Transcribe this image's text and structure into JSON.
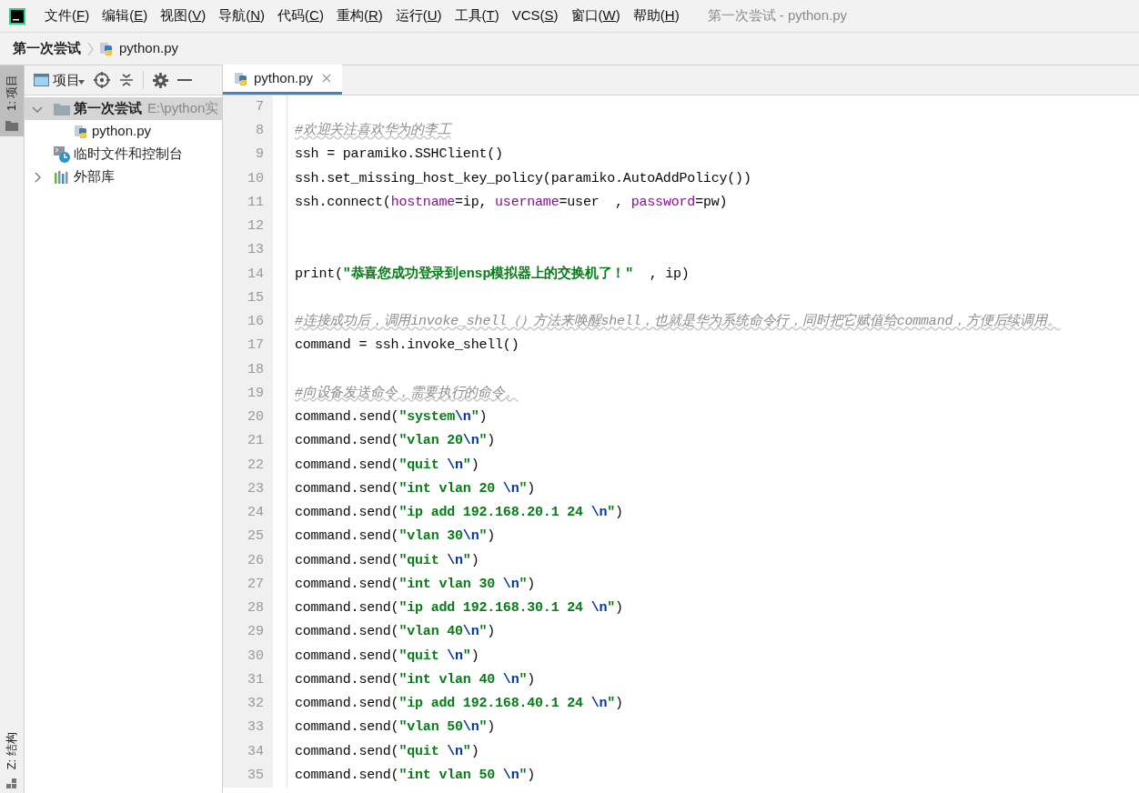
{
  "menu_bar": {
    "items": [
      "文件(F)",
      "编辑(E)",
      "视图(V)",
      "导航(N)",
      "代码(C)",
      "重构(R)",
      "运行(U)",
      "工具(T)",
      "VCS(S)",
      "窗口(W)",
      "帮助(H)"
    ],
    "window_title": "第一次尝试 - python.py"
  },
  "breadcrumb": [
    "第一次尝试",
    "python.py"
  ],
  "side_tabs": [
    {
      "label": "1: 项目",
      "selected": true
    },
    {
      "label": "Z: 结构",
      "selected": false
    }
  ],
  "project_panel": {
    "title": "项目",
    "tree": [
      {
        "kind": "folder",
        "label": "第一次尝试",
        "path": "E:\\python实",
        "expanded": true,
        "selected": true,
        "children": [
          {
            "kind": "python",
            "label": "python.py",
            "selected": false
          }
        ]
      },
      {
        "kind": "scratch",
        "label": "临时文件和控制台",
        "selected": false
      },
      {
        "kind": "library",
        "label": "外部库",
        "expanded": false,
        "selected": false
      }
    ]
  },
  "editor": {
    "tabs": [
      {
        "label": "python.py",
        "selected": true
      }
    ],
    "lines": [
      {
        "number": "7"
      },
      {
        "number": "8",
        "segments": [
          {
            "kind": "comment",
            "text": "#欢迎关注喜欢华为的李工"
          }
        ]
      },
      {
        "number": "9",
        "segments": [
          {
            "kind": "plain",
            "text": "ssh = paramiko.SSHClient()"
          }
        ]
      },
      {
        "number": "10",
        "segments": [
          {
            "kind": "plain",
            "text": "ssh.set_missing_host_key_policy(paramiko.AutoAddPolicy())"
          }
        ]
      },
      {
        "number": "11",
        "segments": [
          {
            "kind": "plain",
            "text": "ssh.connect("
          },
          {
            "kind": "param",
            "text": "hostname"
          },
          {
            "kind": "plain",
            "text": "=ip, "
          },
          {
            "kind": "param",
            "text": "username"
          },
          {
            "kind": "plain",
            "text": "=user  , "
          },
          {
            "kind": "param",
            "text": "password"
          },
          {
            "kind": "plain",
            "text": "=pw)"
          }
        ]
      },
      {
        "number": "12"
      },
      {
        "number": "13"
      },
      {
        "number": "14",
        "segments": [
          {
            "kind": "plain",
            "text": "print("
          },
          {
            "kind": "string",
            "text": "\"恭喜您成功登录到ensp模拟器上的交换机了！\""
          },
          {
            "kind": "plain",
            "text": "  , ip)"
          }
        ]
      },
      {
        "number": "15"
      },
      {
        "number": "16",
        "segments": [
          {
            "kind": "comment",
            "text": "#连接成功后，调用invoke_shell（）方法来唤醒shell，也就是华为系统命令行，同时把它赋值给command，方便后续调用。"
          }
        ]
      },
      {
        "number": "17",
        "segments": [
          {
            "kind": "plain",
            "text": "command = ssh.invoke_shell()"
          }
        ]
      },
      {
        "number": "18"
      },
      {
        "number": "19",
        "segments": [
          {
            "kind": "comment",
            "text": "#向设备发送命令，需要执行的命令。"
          }
        ]
      },
      {
        "number": "20",
        "segments": [
          {
            "kind": "plain",
            "text": "command.send("
          },
          {
            "kind": "string",
            "text": "\"system"
          },
          {
            "kind": "escape",
            "text": "\\n"
          },
          {
            "kind": "string",
            "text": "\""
          },
          {
            "kind": "plain",
            "text": ")"
          }
        ]
      },
      {
        "number": "21",
        "segments": [
          {
            "kind": "plain",
            "text": "command.send("
          },
          {
            "kind": "string",
            "text": "\"vlan 20"
          },
          {
            "kind": "escape",
            "text": "\\n"
          },
          {
            "kind": "string",
            "text": "\""
          },
          {
            "kind": "plain",
            "text": ")"
          }
        ]
      },
      {
        "number": "22",
        "segments": [
          {
            "kind": "plain",
            "text": "command.send("
          },
          {
            "kind": "string",
            "text": "\"quit "
          },
          {
            "kind": "escape",
            "text": "\\n"
          },
          {
            "kind": "string",
            "text": "\""
          },
          {
            "kind": "plain",
            "text": ")"
          }
        ]
      },
      {
        "number": "23",
        "segments": [
          {
            "kind": "plain",
            "text": "command.send("
          },
          {
            "kind": "string",
            "text": "\"int vlan 20 "
          },
          {
            "kind": "escape",
            "text": "\\n"
          },
          {
            "kind": "string",
            "text": "\""
          },
          {
            "kind": "plain",
            "text": ")"
          }
        ]
      },
      {
        "number": "24",
        "segments": [
          {
            "kind": "plain",
            "text": "command.send("
          },
          {
            "kind": "string",
            "text": "\"ip add 192.168.20.1 24 "
          },
          {
            "kind": "escape",
            "text": "\\n"
          },
          {
            "kind": "string",
            "text": "\""
          },
          {
            "kind": "plain",
            "text": ")"
          }
        ]
      },
      {
        "number": "25",
        "segments": [
          {
            "kind": "plain",
            "text": "command.send("
          },
          {
            "kind": "string",
            "text": "\"vlan 30"
          },
          {
            "kind": "escape",
            "text": "\\n"
          },
          {
            "kind": "string",
            "text": "\""
          },
          {
            "kind": "plain",
            "text": ")"
          }
        ]
      },
      {
        "number": "26",
        "segments": [
          {
            "kind": "plain",
            "text": "command.send("
          },
          {
            "kind": "string",
            "text": "\"quit "
          },
          {
            "kind": "escape",
            "text": "\\n"
          },
          {
            "kind": "string",
            "text": "\""
          },
          {
            "kind": "plain",
            "text": ")"
          }
        ]
      },
      {
        "number": "27",
        "segments": [
          {
            "kind": "plain",
            "text": "command.send("
          },
          {
            "kind": "string",
            "text": "\"int vlan 30 "
          },
          {
            "kind": "escape",
            "text": "\\n"
          },
          {
            "kind": "string",
            "text": "\""
          },
          {
            "kind": "plain",
            "text": ")"
          }
        ]
      },
      {
        "number": "28",
        "segments": [
          {
            "kind": "plain",
            "text": "command.send("
          },
          {
            "kind": "string",
            "text": "\"ip add 192.168.30.1 24 "
          },
          {
            "kind": "escape",
            "text": "\\n"
          },
          {
            "kind": "string",
            "text": "\""
          },
          {
            "kind": "plain",
            "text": ")"
          }
        ]
      },
      {
        "number": "29",
        "segments": [
          {
            "kind": "plain",
            "text": "command.send("
          },
          {
            "kind": "string",
            "text": "\"vlan 40"
          },
          {
            "kind": "escape",
            "text": "\\n"
          },
          {
            "kind": "string",
            "text": "\""
          },
          {
            "kind": "plain",
            "text": ")"
          }
        ]
      },
      {
        "number": "30",
        "segments": [
          {
            "kind": "plain",
            "text": "command.send("
          },
          {
            "kind": "string",
            "text": "\"quit "
          },
          {
            "kind": "escape",
            "text": "\\n"
          },
          {
            "kind": "string",
            "text": "\""
          },
          {
            "kind": "plain",
            "text": ")"
          }
        ]
      },
      {
        "number": "31",
        "segments": [
          {
            "kind": "plain",
            "text": "command.send("
          },
          {
            "kind": "string",
            "text": "\"int vlan 40 "
          },
          {
            "kind": "escape",
            "text": "\\n"
          },
          {
            "kind": "string",
            "text": "\""
          },
          {
            "kind": "plain",
            "text": ")"
          }
        ]
      },
      {
        "number": "32",
        "segments": [
          {
            "kind": "plain",
            "text": "command.send("
          },
          {
            "kind": "string",
            "text": "\"ip add 192.168.40.1 24 "
          },
          {
            "kind": "escape",
            "text": "\\n"
          },
          {
            "kind": "string",
            "text": "\""
          },
          {
            "kind": "plain",
            "text": ")"
          }
        ]
      },
      {
        "number": "33",
        "segments": [
          {
            "kind": "plain",
            "text": "command.send("
          },
          {
            "kind": "string",
            "text": "\"vlan 50"
          },
          {
            "kind": "escape",
            "text": "\\n"
          },
          {
            "kind": "string",
            "text": "\""
          },
          {
            "kind": "plain",
            "text": ")"
          }
        ]
      },
      {
        "number": "34",
        "segments": [
          {
            "kind": "plain",
            "text": "command.send("
          },
          {
            "kind": "string",
            "text": "\"quit "
          },
          {
            "kind": "escape",
            "text": "\\n"
          },
          {
            "kind": "string",
            "text": "\""
          },
          {
            "kind": "plain",
            "text": ")"
          }
        ]
      },
      {
        "number": "35",
        "segments": [
          {
            "kind": "plain",
            "text": "command.send("
          },
          {
            "kind": "string",
            "text": "\"int vlan 50 "
          },
          {
            "kind": "escape",
            "text": "\\n"
          },
          {
            "kind": "string",
            "text": "\""
          },
          {
            "kind": "plain",
            "text": ")"
          }
        ]
      }
    ]
  }
}
